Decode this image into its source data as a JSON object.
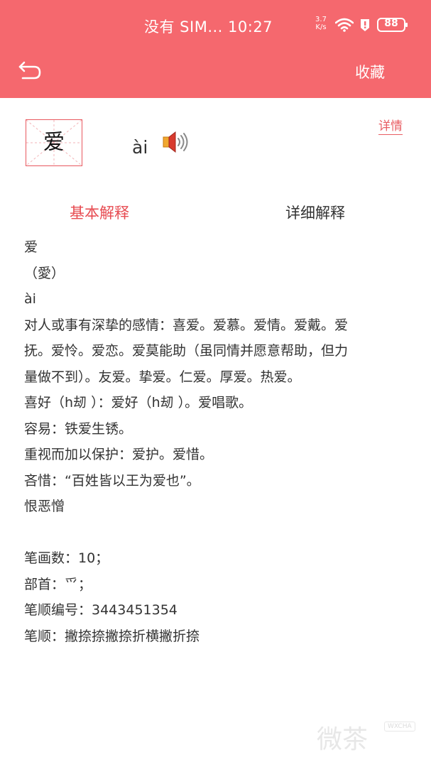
{
  "status_bar": {
    "carrier_time": "没有 SIM... 10:27",
    "speed_value": "3.7",
    "speed_unit": "K/s",
    "battery": "88"
  },
  "header": {
    "favorite_label": "收藏",
    "back_icon": "back-arrow-icon",
    "background_color": "#F5686E"
  },
  "character": {
    "glyph": "爱",
    "pinyin": "ài",
    "speaker_icon": "speaker-icon",
    "detail_link": "详情"
  },
  "tabs": [
    {
      "label": "基本解释",
      "active": true
    },
    {
      "label": "详细解释",
      "active": false
    }
  ],
  "definition_lines": [
    "爱",
    "（愛）",
    "ài",
    "对人或事有深挚的感情：喜爱。爱慕。爱情。爱戴。爱",
    "抚。爱怜。爱恋。爱莫能助（虽同情并愿意帮助，但力",
    "量做不到）。友爱。挚爱。仁爱。厚爱。热爱。",
    "喜好（h刼 ）：爱好（h刼 ）。爱唱歌。",
    "容易：铁爱生锈。",
    "重视而加以保护：爱护。爱惜。",
    "吝惜：“百姓皆以王为爱也”。",
    "恨恶憎"
  ],
  "info": {
    "stroke_count": "笔画数：10；",
    "radical": "部首：爫；",
    "stroke_code": "笔顺编号：3443451354",
    "stroke_order": "笔顺：撇捺捺撇捺折横撇折捺"
  },
  "watermark": {
    "text": "微茶",
    "tag": "WXCHA"
  },
  "colors": {
    "accent": "#F5686E",
    "active_tab": "#E74C52",
    "text": "#333333"
  }
}
